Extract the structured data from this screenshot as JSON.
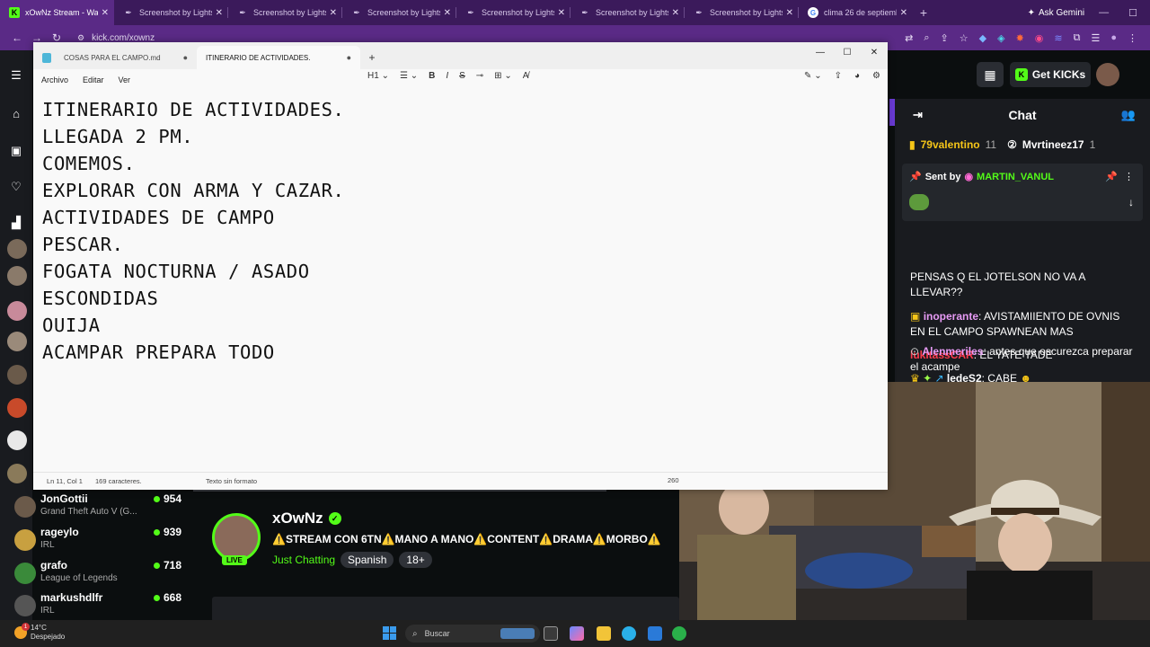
{
  "browser": {
    "tabs": [
      {
        "label": "xOwNz Stream - Watc",
        "icon": "kick-logo",
        "active": true
      },
      {
        "label": "Screenshot by Lightsh",
        "icon": "lightshot-feather-icon"
      },
      {
        "label": "Screenshot by Lightsh",
        "icon": "lightshot-feather-icon"
      },
      {
        "label": "Screenshot by Lightsh",
        "icon": "lightshot-feather-icon"
      },
      {
        "label": "Screenshot by Lightsh",
        "icon": "lightshot-feather-icon"
      },
      {
        "label": "Screenshot by Lightsh",
        "icon": "lightshot-feather-icon"
      },
      {
        "label": "Screenshot by Lightsh",
        "icon": "lightshot-feather-icon"
      },
      {
        "label": "clima 26 de septiemb",
        "icon": "google-icon"
      }
    ],
    "ask_gemini": "Ask Gemini",
    "url": "kick.com/xownz",
    "accent": "#5a2a86"
  },
  "notepad": {
    "tabs": [
      {
        "label": "COSAS PARA EL CAMPO.md"
      },
      {
        "label": "ITINERARIO DE ACTIVIDADES."
      }
    ],
    "menu": [
      "Archivo",
      "Editar",
      "Ver"
    ],
    "heading_select": "H1",
    "lines": [
      "ITINERARIO DE ACTIVIDADES.",
      "LLEGADA 2 PM.",
      "COMEMOS.",
      "EXPLORAR CON ARMA Y CAZAR.",
      "ACTIVIDADES DE CAMPO",
      "PESCAR.",
      "FOGATA NOCTURNA / ASADO",
      "ESCONDIDAS",
      "OUIJA",
      "ACAMPAR PREPARA TODO"
    ],
    "status": {
      "position": "Ln 11, Col 1",
      "chars": "169 caracteres.",
      "format": "Texto sin formato",
      "zoom_partial": "260"
    }
  },
  "kick": {
    "get_kicks": "Get KICKs",
    "brand_color": "#53fc18",
    "chat": {
      "title": "Chat",
      "top_gifters": [
        {
          "name": "79valentino",
          "count": "11",
          "color": "#f5c518"
        },
        {
          "name": "Mvrtineez17",
          "count": "1",
          "color": "#ffffff"
        }
      ],
      "pinned_prefix": "Sent by",
      "pinned_user": "MARTIN_VANUL",
      "messages": [
        {
          "user": "",
          "text": "PENSAS Q EL JOTELSON NO VA A LLEVAR??",
          "color": "#ffffff"
        },
        {
          "user": "inoperante",
          "text": ": AVISTAMIIENTO DE OVNIS EN EL CAMPO SPAWNEAN MAS",
          "color": "#e79bf5"
        },
        {
          "user": "lukitassCAR",
          "text": ": EL YATE TADE",
          "color": "#ff3b4e"
        },
        {
          "user": "ledeS2",
          "text": ": CABE",
          "color": "#ffffff"
        },
        {
          "user": "Alenmeriles",
          "text": ": antes que oscurezca preparar el acampe",
          "color": "#e79bf5"
        }
      ]
    },
    "stream": {
      "name": "xOwNz",
      "live": "LIVE",
      "title": "⚠️STREAM CON 6TN⚠️MANO A MANO⚠️CONTENT⚠️DRAMA⚠️MORBO⚠️",
      "category": "Just Chatting",
      "tags": [
        "Spanish",
        "18+"
      ]
    },
    "recommended": [
      {
        "name": "JonGottii",
        "game": "Grand Theft Auto V (G...",
        "viewers": "954",
        "avatar": "#6b5a4a"
      },
      {
        "name": "rageylo",
        "game": "IRL",
        "viewers": "939",
        "avatar": "#c8a040"
      },
      {
        "name": "grafo",
        "game": "League of Legends",
        "viewers": "718",
        "avatar": "#3a8a3a"
      },
      {
        "name": "markushdlfr",
        "game": "IRL",
        "viewers": "668",
        "avatar": "#555555"
      }
    ]
  },
  "taskbar": {
    "temperature": "14°C",
    "weather": "Despejado",
    "notification_count": "1",
    "search_placeholder": "Buscar"
  }
}
